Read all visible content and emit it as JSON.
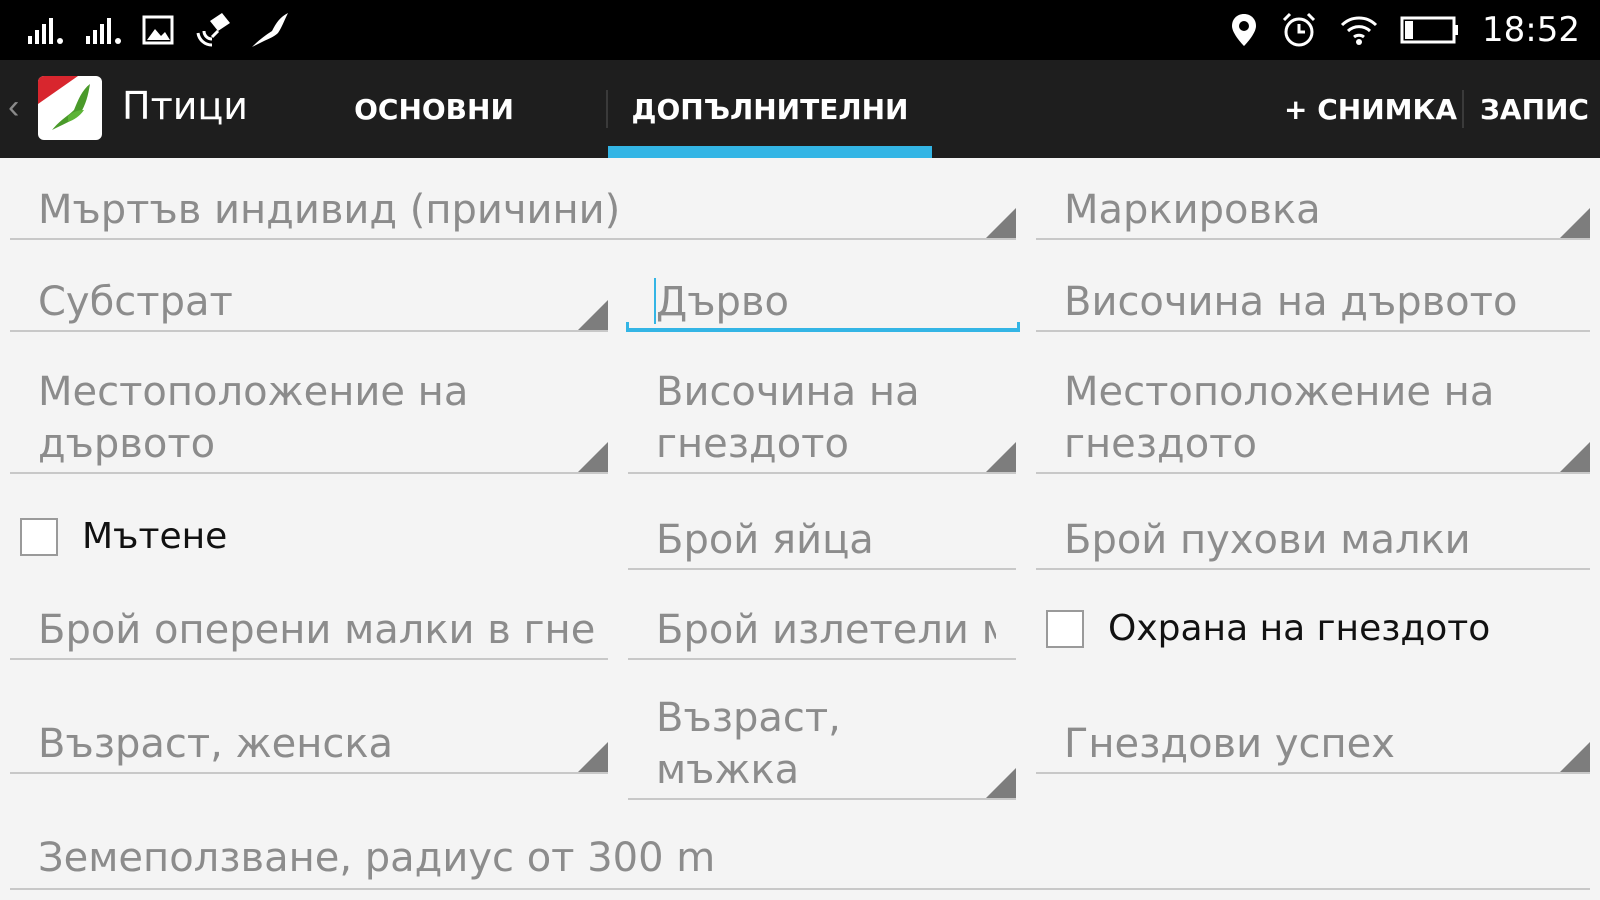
{
  "status_bar": {
    "time": "18:52",
    "left_icons": [
      "signal-icon",
      "signal-icon",
      "image-icon",
      "satellite-icon",
      "bird-icon"
    ],
    "right_icons": [
      "location-icon",
      "alarm-icon",
      "wifi-icon",
      "battery-icon"
    ]
  },
  "action_bar": {
    "app_title": "Птици",
    "tabs": [
      {
        "label": "ОСНОВНИ",
        "active": false
      },
      {
        "label": "ДОПЪЛНИТЕЛНИ",
        "active": true
      }
    ],
    "add_photo_label": "+ СНИМКА",
    "save_label": "ЗАПИС",
    "accent_color": "#33b5e5"
  },
  "form": {
    "dead_individual": "Мъртъв индивид (причини)",
    "marking": "Маркировка",
    "substrate": "Субстрат",
    "tree": "Дърво",
    "tree_height": "Височина на дървото",
    "tree_location": "Местоположение на\nдървото",
    "nest_height": "Височина на\nгнездото",
    "nest_location": "Местоположение на\nгнездото",
    "mating_label": "Мътене",
    "egg_count": "Брой яйца",
    "downy_chicks": "Брой пухови малки",
    "feathered_chicks": "Брой оперени малки в гнездото",
    "fledged_count": "Брой излетели малки",
    "nest_protection_label": "Охрана на гнездото",
    "female_age": "Възраст, женска",
    "male_age": "Възраст,\nмъжка",
    "nesting_success": "Гнездови успех",
    "land_use": "Земеползване, радиус от 300 m"
  }
}
